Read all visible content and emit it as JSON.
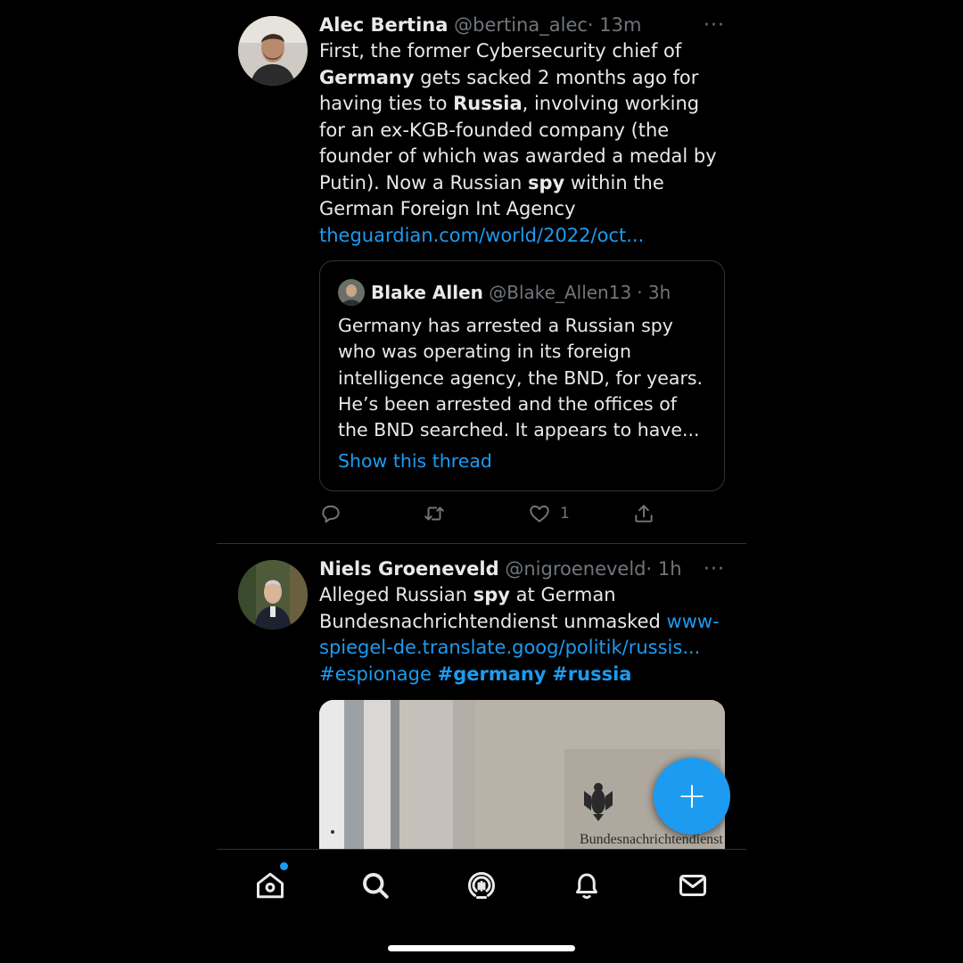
{
  "tweets": [
    {
      "name": "Alec Bertina",
      "handle": "@bertina_alec",
      "time": "· 13m",
      "more": "···",
      "text": [
        {
          "t": "First, the former Cybersecurity chief of ",
          "b": false
        },
        {
          "t": "Germany",
          "b": true
        },
        {
          "t": " gets sacked 2 months ago for having ties to ",
          "b": false
        },
        {
          "t": "Russia",
          "b": true
        },
        {
          "t": ", involving working for an ex-KGB-founded company (the founder of which was awarded a medal by Putin). Now a Russian ",
          "b": false
        },
        {
          "t": "spy",
          "b": true
        },
        {
          "t": " within the German Foreign Int Agency",
          "b": false
        }
      ],
      "link": "theguardian.com/world/2022/oct...",
      "quote": {
        "name": "Blake Allen",
        "handle": "@Blake_Allen13",
        "time": "· 3h",
        "text": "Germany has arrested a Russian spy who was operating in its foreign intelligence agency, the BND, for years. He’s been arrested and the offices of the BND searched. It appears to have...",
        "show_thread": "Show this thread"
      },
      "actions": {
        "reply_icon": "reply-icon",
        "retweet_icon": "retweet-icon",
        "like_icon": "heart-icon",
        "like_count": "1",
        "share_icon": "share-icon"
      }
    },
    {
      "name": "Niels Groeneveld",
      "handle": "@nigroeneveld",
      "time": "· 1h",
      "more": "···",
      "text_pre": [
        {
          "t": "Alleged Russian ",
          "b": false
        },
        {
          "t": "spy",
          "b": true
        },
        {
          "t": " at German Bundesnachrichtendienst unmasked ",
          "b": false
        }
      ],
      "link": "www-spiegel-de.translate.goog/politik/russis...",
      "hashtags": [
        {
          "t": "#espionage",
          "b": false
        },
        {
          "t": "#germany",
          "b": true
        },
        {
          "t": "#russia",
          "b": true
        }
      ],
      "media_caption": "Bundesnachrichtendienst"
    }
  ],
  "compose_button": "compose-tweet-icon",
  "tabbar": {
    "items": [
      "home-icon",
      "search-icon",
      "spaces-icon",
      "notifications-icon",
      "messages-icon"
    ],
    "home_badge": true
  },
  "colors": {
    "background": "#000000",
    "accent": "#1d9bf0",
    "text": "#e7e9ea",
    "muted": "#71767b",
    "border": "#2f3336"
  }
}
